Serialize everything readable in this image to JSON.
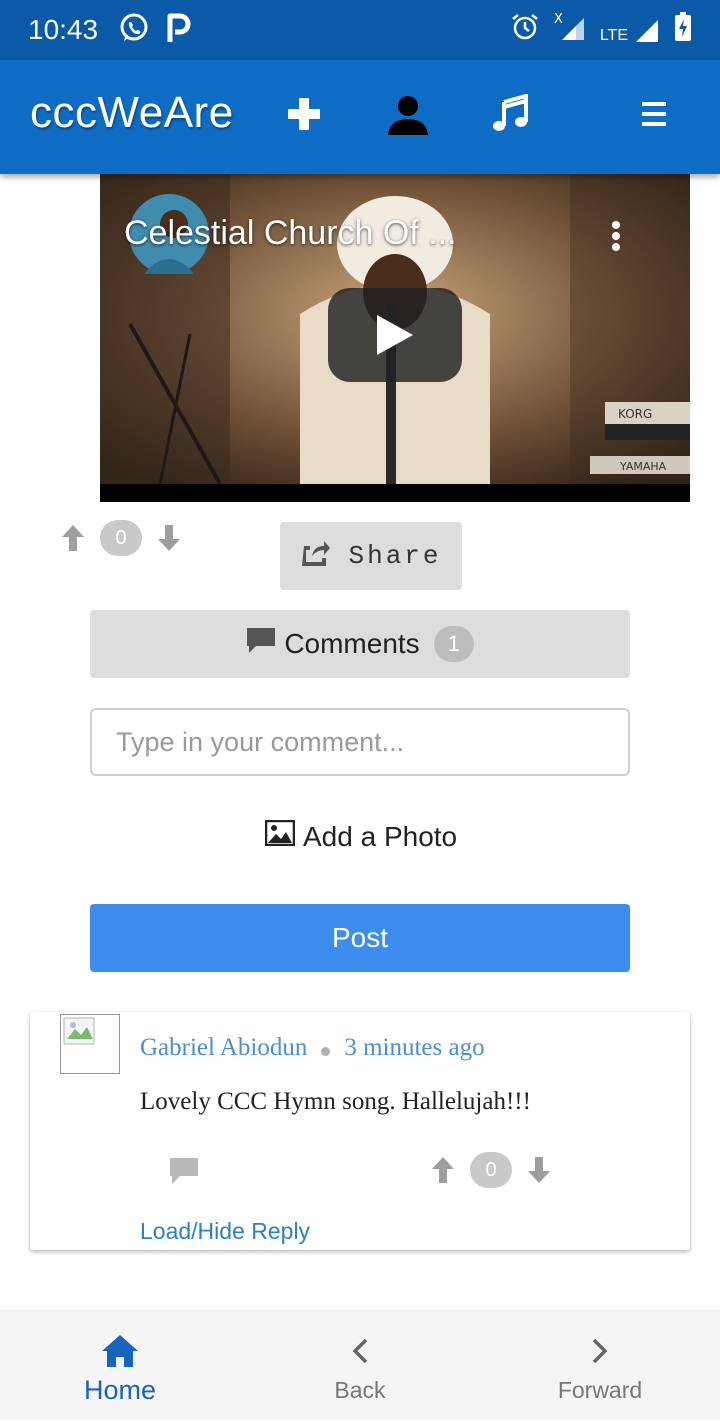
{
  "status_bar": {
    "time": "10:43",
    "left_icons": [
      "whatsapp-icon",
      "parking-icon"
    ],
    "right_icons": [
      "alarm-icon",
      "signal-x-icon",
      "lte-signal-icon",
      "battery-charging-icon"
    ],
    "lte_label": "LTE"
  },
  "app_bar": {
    "title": "cccWeAre",
    "icons": [
      "plus-icon",
      "user-icon",
      "music-icon",
      "menu-icon"
    ],
    "color": "#0e6cc5"
  },
  "video": {
    "title": "Celestial Church Of ...",
    "brand_labels": [
      "KORG",
      "YAMAHA"
    ]
  },
  "post_votes": {
    "count": "0"
  },
  "share": {
    "label": "Share"
  },
  "comments_button": {
    "label": "Comments",
    "count": "1"
  },
  "comment_form": {
    "placeholder": "Type in your comment...",
    "add_photo_label": "Add a Photo",
    "post_label": "Post",
    "post_color": "#3c8ded"
  },
  "comments": [
    {
      "author": "Gabriel Abiodun",
      "time": "3 minutes ago",
      "text": "Lovely CCC Hymn song. Hallelujah!!!",
      "votes": "0",
      "load_reply_label": "Load/Hide Reply"
    }
  ],
  "bottom_nav": {
    "items": [
      {
        "label": "Home",
        "icon": "home-icon",
        "active": true
      },
      {
        "label": "Back",
        "icon": "chevron-left-icon",
        "active": false
      },
      {
        "label": "Forward",
        "icon": "chevron-right-icon",
        "active": false
      }
    ],
    "active_color": "#1565c0"
  }
}
